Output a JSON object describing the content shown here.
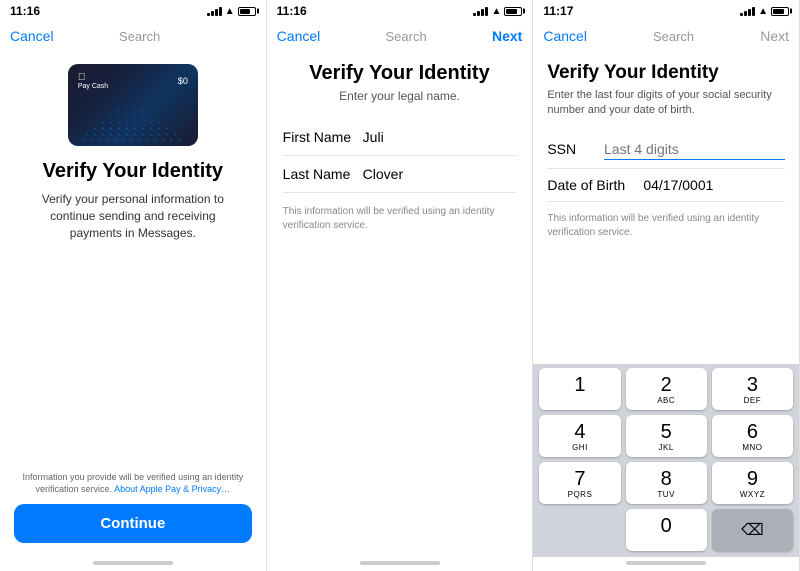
{
  "screens": [
    {
      "id": "screen1",
      "statusBar": {
        "time": "11:16",
        "hasArrow": true
      },
      "nav": {
        "cancel": "Cancel",
        "title": "Search",
        "next": null
      },
      "card": {
        "brand": "Apple Pay Cash",
        "amount": "$0"
      },
      "title": "Verify Your Identity",
      "subtitle": "Verify your personal information to continue sending and receiving payments in Messages.",
      "privacyText": "Information you provide will be verified using an identity verification service.",
      "privacyLink": "About Apple Pay & Privacy…",
      "continueBtn": "Continue"
    },
    {
      "id": "screen2",
      "statusBar": {
        "time": "11:16",
        "hasArrow": true
      },
      "nav": {
        "cancel": "Cancel",
        "title": "Search",
        "next": "Next",
        "nextActive": true
      },
      "title": "Verify Your Identity",
      "subtitle": "Enter your legal name.",
      "fields": [
        {
          "label": "First Name",
          "value": "Juli"
        },
        {
          "label": "Last Name",
          "value": "Clover"
        }
      ],
      "disclaimer": "This information will be verified using an identity verification service."
    },
    {
      "id": "screen3",
      "statusBar": {
        "time": "11:17",
        "hasArrow": true
      },
      "nav": {
        "cancel": "Cancel",
        "title": "Search",
        "next": "Next",
        "nextActive": false
      },
      "title": "Verify Your Identity",
      "subtitle": "Enter the last four digits of your social security number and your date of birth.",
      "ssnLabel": "SSN",
      "ssnPlaceholder": "Last 4 digits",
      "dobLabel": "Date of Birth",
      "dobValue": "04/17/0001",
      "disclaimer": "This information will be verified using an identity verification service.",
      "keypad": {
        "keys": [
          {
            "num": "1",
            "letters": ""
          },
          {
            "num": "2",
            "letters": "ABC"
          },
          {
            "num": "3",
            "letters": "DEF"
          },
          {
            "num": "4",
            "letters": "GHI"
          },
          {
            "num": "5",
            "letters": "JKL"
          },
          {
            "num": "6",
            "letters": "MNO"
          },
          {
            "num": "7",
            "letters": "PQRS"
          },
          {
            "num": "8",
            "letters": "TUV"
          },
          {
            "num": "9",
            "letters": "WXYZ"
          },
          {
            "num": "",
            "letters": "",
            "type": "empty"
          },
          {
            "num": "0",
            "letters": ""
          },
          {
            "num": "⌫",
            "letters": "",
            "type": "delete"
          }
        ]
      }
    }
  ]
}
